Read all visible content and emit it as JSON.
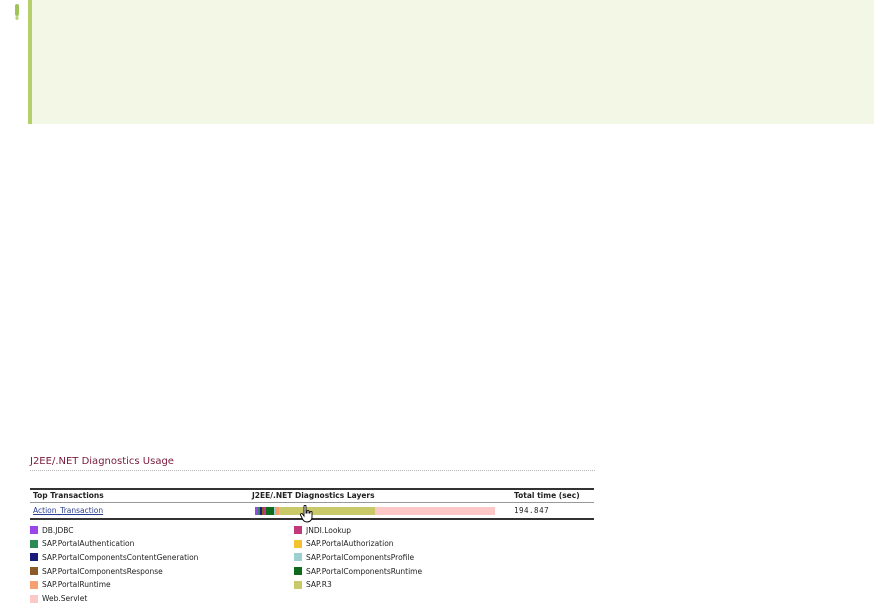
{
  "panel": {
    "title": "J2EE/.NET Diagnostics Usage",
    "table": {
      "headers": [
        "Top Transactions",
        "J2EE/.NET Diagnostics Layers",
        "Total time (sec)"
      ],
      "rows": [
        {
          "transaction": "Action_Transaction",
          "total_time": "194.847",
          "layers": [
            {
              "name": "DB.JDBC",
              "color": "#9b45ea",
              "fraction": 0.012
            },
            {
              "name": "SAP.PortalAuthentication",
              "color": "#2e8b57",
              "fraction": 0.01
            },
            {
              "name": "SAP.PortalComponentsContentGeneration",
              "color": "#1a1a7a",
              "fraction": 0.008
            },
            {
              "name": "SAP.PortalComponentsResponse",
              "color": "#8b5a2b",
              "fraction": 0.008
            },
            {
              "name": "JNDI.Lookup",
              "color": "#c0397a",
              "fraction": 0.006
            },
            {
              "name": "SAP.PortalComponentsRuntime",
              "color": "#0e6b1e",
              "fraction": 0.035
            },
            {
              "name": "SAP.PortalComponentsProfile",
              "color": "#9ccfcf",
              "fraction": 0.006
            },
            {
              "name": "SAP.PortalRuntime",
              "color": "#f4a070",
              "fraction": 0.015
            },
            {
              "name": "SAP.R3",
              "color": "#c9c96a",
              "fraction": 0.4
            },
            {
              "name": "Web.Servlet",
              "color": "#fcc8c8",
              "fraction": 0.5
            }
          ]
        }
      ]
    },
    "legend": [
      {
        "label": "DB.JDBC",
        "color": "#9b45ea"
      },
      {
        "label": "JNDI.Lookup",
        "color": "#c0397a"
      },
      {
        "label": "SAP.PortalAuthentication",
        "color": "#2e8b57"
      },
      {
        "label": "SAP.PortalAuthorization",
        "color": "#f2c232"
      },
      {
        "label": "SAP.PortalComponentsContentGeneration",
        "color": "#1a1a7a"
      },
      {
        "label": "SAP.PortalComponentsProfile",
        "color": "#9ccfcf"
      },
      {
        "label": "SAP.PortalComponentsResponse",
        "color": "#8b5a2b"
      },
      {
        "label": "SAP.PortalComponentsRuntime",
        "color": "#0e6b1e"
      },
      {
        "label": "SAP.PortalRuntime",
        "color": "#f4a070"
      },
      {
        "label": "SAP.R3",
        "color": "#c9c96a"
      },
      {
        "label": "Web.Servlet",
        "color": "#fcc8c8"
      }
    ]
  }
}
